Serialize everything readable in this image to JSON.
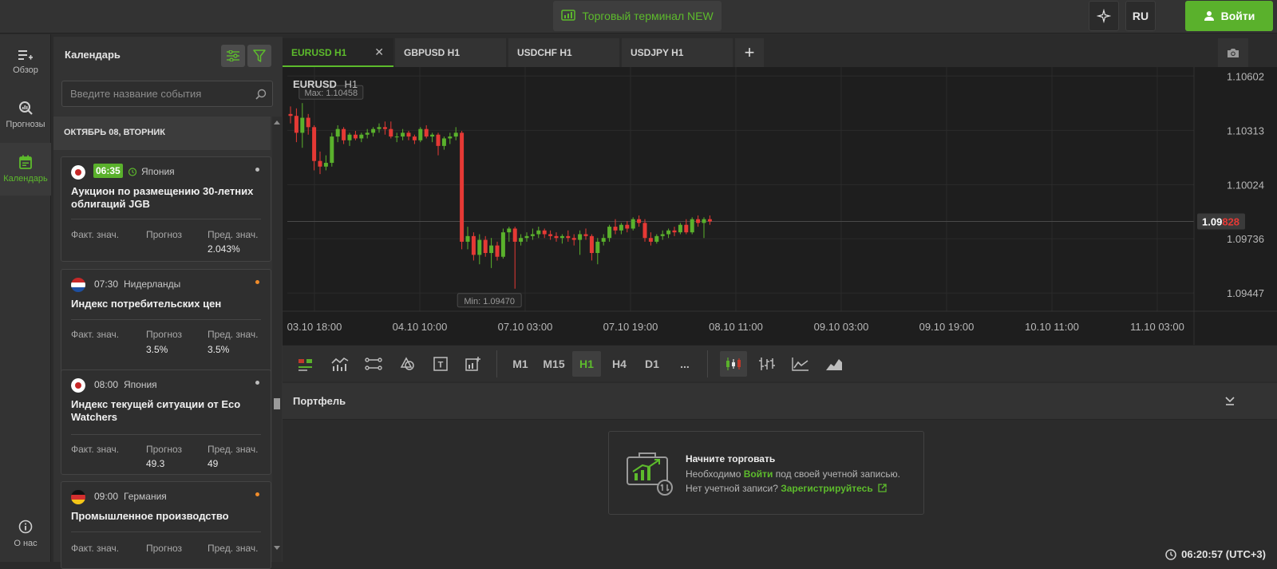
{
  "header": {
    "terminal_label": "Торговый терминал NEW",
    "language": "RU",
    "login_label": "Войти"
  },
  "nav": {
    "items": [
      {
        "label": "Обзор",
        "icon": "list-add-icon"
      },
      {
        "label": "Прогнозы",
        "icon": "search-chart-icon"
      },
      {
        "label": "Календарь",
        "icon": "calendar-icon",
        "active": true
      },
      {
        "label": "О нас",
        "icon": "info-icon"
      }
    ]
  },
  "calendar": {
    "title": "Календарь",
    "search_placeholder": "Введите название события",
    "date_header": "ОКТЯБРЬ 08, ВТОРНИК",
    "col_actual": "Факт. знач.",
    "col_forecast": "Прогноз",
    "col_previous": "Пред. знач.",
    "events": [
      {
        "time": "06:35",
        "country": "Япония",
        "flag": "japan",
        "name": "Аукцион по размещению 30-летних облигаций JGB",
        "actual": "",
        "forecast": "",
        "previous": "2.043%",
        "importance_color": "#bdbdbd"
      },
      {
        "time": "07:30",
        "country": "Нидерланды",
        "flag": "netherlands",
        "name": "Индекс потребительских цен",
        "actual": "",
        "forecast": "3.5%",
        "previous": "3.5%",
        "importance_color": "#f08c2a"
      },
      {
        "time": "08:00",
        "country": "Япония",
        "flag": "japan",
        "name": "Индекс текущей ситуации от Eco Watchers",
        "actual": "",
        "forecast": "49.3",
        "previous": "49",
        "importance_color": "#bdbdbd"
      },
      {
        "time": "09:00",
        "country": "Германия",
        "flag": "germany",
        "name": "Промышленное производство",
        "actual": "",
        "forecast": "",
        "previous": "",
        "importance_color": "#f08c2a"
      }
    ]
  },
  "chart": {
    "tabs": [
      {
        "label": "EURUSD H1",
        "active": true
      },
      {
        "label": "GBPUSD H1"
      },
      {
        "label": "USDCHF H1"
      },
      {
        "label": "USDJPY H1"
      }
    ],
    "symbol": "EURUSD",
    "timeframe": "H1",
    "max_label": "Max: 1.10458",
    "min_label": "Min: 1.09470",
    "current_price_main": "1.09",
    "current_price_tail": "828",
    "timeframes": [
      "M1",
      "M15",
      "H1",
      "H4",
      "D1",
      "..."
    ],
    "active_timeframe": "H1"
  },
  "chart_data": {
    "type": "candlestick",
    "yticks": [
      "1.10602",
      "1.10313",
      "1.10024",
      "1.09736",
      "1.09447"
    ],
    "ytick_values": [
      1.10602,
      1.10313,
      1.10024,
      1.09736,
      1.09447
    ],
    "xticks": [
      "03.10 18:00",
      "04.10 10:00",
      "07.10 03:00",
      "07.10 19:00",
      "08.10 11:00",
      "09.10 03:00",
      "09.10 19:00",
      "10.10 11:00",
      "11.10 03:00"
    ],
    "ylim": [
      1.0935,
      1.1065
    ],
    "current_price": 1.09828,
    "up_color": "#5ab12c",
    "down_color": "#e53935",
    "candles": [
      {
        "o": 1.104,
        "h": 1.1044,
        "l": 1.1035,
        "c": 1.1039
      },
      {
        "o": 1.1039,
        "h": 1.1043,
        "l": 1.1025,
        "c": 1.103
      },
      {
        "o": 1.103,
        "h": 1.10458,
        "l": 1.1022,
        "c": 1.1038
      },
      {
        "o": 1.1038,
        "h": 1.104,
        "l": 1.1029,
        "c": 1.1033
      },
      {
        "o": 1.1033,
        "h": 1.1034,
        "l": 1.101,
        "c": 1.1015
      },
      {
        "o": 1.1015,
        "h": 1.102,
        "l": 1.1008,
        "c": 1.1012
      },
      {
        "o": 1.1012,
        "h": 1.1018,
        "l": 1.101,
        "c": 1.1014
      },
      {
        "o": 1.1014,
        "h": 1.103,
        "l": 1.1012,
        "c": 1.1028
      },
      {
        "o": 1.1028,
        "h": 1.1034,
        "l": 1.1025,
        "c": 1.1032
      },
      {
        "o": 1.1032,
        "h": 1.1033,
        "l": 1.1024,
        "c": 1.1026
      },
      {
        "o": 1.1026,
        "h": 1.103,
        "l": 1.1023,
        "c": 1.1029
      },
      {
        "o": 1.1029,
        "h": 1.1031,
        "l": 1.1026,
        "c": 1.1027
      },
      {
        "o": 1.1027,
        "h": 1.103,
        "l": 1.1025,
        "c": 1.1029
      },
      {
        "o": 1.1029,
        "h": 1.1032,
        "l": 1.1027,
        "c": 1.103
      },
      {
        "o": 1.103,
        "h": 1.1033,
        "l": 1.1028,
        "c": 1.1032
      },
      {
        "o": 1.1032,
        "h": 1.1035,
        "l": 1.103,
        "c": 1.1033
      },
      {
        "o": 1.1033,
        "h": 1.1036,
        "l": 1.1029,
        "c": 1.1032
      },
      {
        "o": 1.1032,
        "h": 1.1036,
        "l": 1.1027,
        "c": 1.1028
      },
      {
        "o": 1.1028,
        "h": 1.103,
        "l": 1.1025,
        "c": 1.1028
      },
      {
        "o": 1.1028,
        "h": 1.1032,
        "l": 1.1026,
        "c": 1.103
      },
      {
        "o": 1.103,
        "h": 1.1031,
        "l": 1.1026,
        "c": 1.1028
      },
      {
        "o": 1.1028,
        "h": 1.1029,
        "l": 1.1024,
        "c": 1.1026
      },
      {
        "o": 1.1026,
        "h": 1.1033,
        "l": 1.1025,
        "c": 1.1032
      },
      {
        "o": 1.1032,
        "h": 1.1034,
        "l": 1.1027,
        "c": 1.1028
      },
      {
        "o": 1.1028,
        "h": 1.103,
        "l": 1.1025,
        "c": 1.1029
      },
      {
        "o": 1.1029,
        "h": 1.103,
        "l": 1.1018,
        "c": 1.1023
      },
      {
        "o": 1.1023,
        "h": 1.1028,
        "l": 1.1021,
        "c": 1.1027
      },
      {
        "o": 1.1027,
        "h": 1.103,
        "l": 1.1024,
        "c": 1.1028
      },
      {
        "o": 1.1028,
        "h": 1.1033,
        "l": 1.1026,
        "c": 1.103
      },
      {
        "o": 1.103,
        "h": 1.1031,
        "l": 1.0968,
        "c": 1.0972
      },
      {
        "o": 1.0972,
        "h": 1.098,
        "l": 1.0968,
        "c": 1.0975
      },
      {
        "o": 1.0975,
        "h": 1.0977,
        "l": 1.0962,
        "c": 1.0965
      },
      {
        "o": 1.0965,
        "h": 1.0976,
        "l": 1.096,
        "c": 1.0973
      },
      {
        "o": 1.0973,
        "h": 1.0975,
        "l": 1.0964,
        "c": 1.0966
      },
      {
        "o": 1.0966,
        "h": 1.0974,
        "l": 1.0958,
        "c": 1.097
      },
      {
        "o": 1.097,
        "h": 1.0972,
        "l": 1.0962,
        "c": 1.0964
      },
      {
        "o": 1.0964,
        "h": 1.0979,
        "l": 1.0963,
        "c": 1.0977
      },
      {
        "o": 1.0977,
        "h": 1.098,
        "l": 1.0972,
        "c": 1.0979
      },
      {
        "o": 1.0979,
        "h": 1.098,
        "l": 1.0947,
        "c": 1.0972
      },
      {
        "o": 1.0972,
        "h": 1.0976,
        "l": 1.097,
        "c": 1.0974
      },
      {
        "o": 1.0974,
        "h": 1.0977,
        "l": 1.0972,
        "c": 1.0975
      },
      {
        "o": 1.0975,
        "h": 1.0979,
        "l": 1.0973,
        "c": 1.0976
      },
      {
        "o": 1.0976,
        "h": 1.098,
        "l": 1.0974,
        "c": 1.0978
      },
      {
        "o": 1.0978,
        "h": 1.0979,
        "l": 1.0974,
        "c": 1.0976
      },
      {
        "o": 1.0976,
        "h": 1.0978,
        "l": 1.0973,
        "c": 1.0975
      },
      {
        "o": 1.0975,
        "h": 1.0977,
        "l": 1.0972,
        "c": 1.0974
      },
      {
        "o": 1.0974,
        "h": 1.0976,
        "l": 1.0971,
        "c": 1.0975
      },
      {
        "o": 1.0975,
        "h": 1.0978,
        "l": 1.0972,
        "c": 1.0974
      },
      {
        "o": 1.0974,
        "h": 1.0976,
        "l": 1.097,
        "c": 1.0973
      },
      {
        "o": 1.0973,
        "h": 1.0978,
        "l": 1.0965,
        "c": 1.0976
      },
      {
        "o": 1.0976,
        "h": 1.0979,
        "l": 1.0973,
        "c": 1.0975
      },
      {
        "o": 1.0975,
        "h": 1.0976,
        "l": 1.0962,
        "c": 1.0966
      },
      {
        "o": 1.0966,
        "h": 1.0974,
        "l": 1.096,
        "c": 1.0972
      },
      {
        "o": 1.0972,
        "h": 1.0976,
        "l": 1.097,
        "c": 1.0974
      },
      {
        "o": 1.0974,
        "h": 1.0981,
        "l": 1.0972,
        "c": 1.098
      },
      {
        "o": 1.098,
        "h": 1.0984,
        "l": 1.0976,
        "c": 1.0978
      },
      {
        "o": 1.0978,
        "h": 1.0982,
        "l": 1.0976,
        "c": 1.0981
      },
      {
        "o": 1.0981,
        "h": 1.0983,
        "l": 1.0977,
        "c": 1.0979
      },
      {
        "o": 1.0979,
        "h": 1.0985,
        "l": 1.0978,
        "c": 1.0984
      },
      {
        "o": 1.0984,
        "h": 1.0986,
        "l": 1.098,
        "c": 1.0982
      },
      {
        "o": 1.0982,
        "h": 1.0984,
        "l": 1.0972,
        "c": 1.0974
      },
      {
        "o": 1.0974,
        "h": 1.0977,
        "l": 1.097,
        "c": 1.0972
      },
      {
        "o": 1.0972,
        "h": 1.0976,
        "l": 1.0971,
        "c": 1.0975
      },
      {
        "o": 1.0975,
        "h": 1.0978,
        "l": 1.0973,
        "c": 1.0976
      },
      {
        "o": 1.0976,
        "h": 1.0979,
        "l": 1.0974,
        "c": 1.0978
      },
      {
        "o": 1.0978,
        "h": 1.098,
        "l": 1.0975,
        "c": 1.0977
      },
      {
        "o": 1.0977,
        "h": 1.0982,
        "l": 1.0976,
        "c": 1.0981
      },
      {
        "o": 1.0981,
        "h": 1.0984,
        "l": 1.0976,
        "c": 1.0977
      },
      {
        "o": 1.0977,
        "h": 1.0985,
        "l": 1.0976,
        "c": 1.0984
      },
      {
        "o": 1.0984,
        "h": 1.0986,
        "l": 1.098,
        "c": 1.0982
      },
      {
        "o": 1.0982,
        "h": 1.0985,
        "l": 1.0974,
        "c": 1.0984
      },
      {
        "o": 1.0984,
        "h": 1.0986,
        "l": 1.0981,
        "c": 1.09828
      }
    ]
  },
  "portfolio": {
    "title": "Портфель",
    "start_title": "Начните торговать",
    "need_prefix": "Необходимо ",
    "need_link": "Войти",
    "need_suffix": " под своей учетной записью.",
    "no_account": "Нет учетной записи? ",
    "register_link": "Зарегистрируйтесь"
  },
  "status": {
    "clock": "06:20:57 (UTC+3)"
  }
}
